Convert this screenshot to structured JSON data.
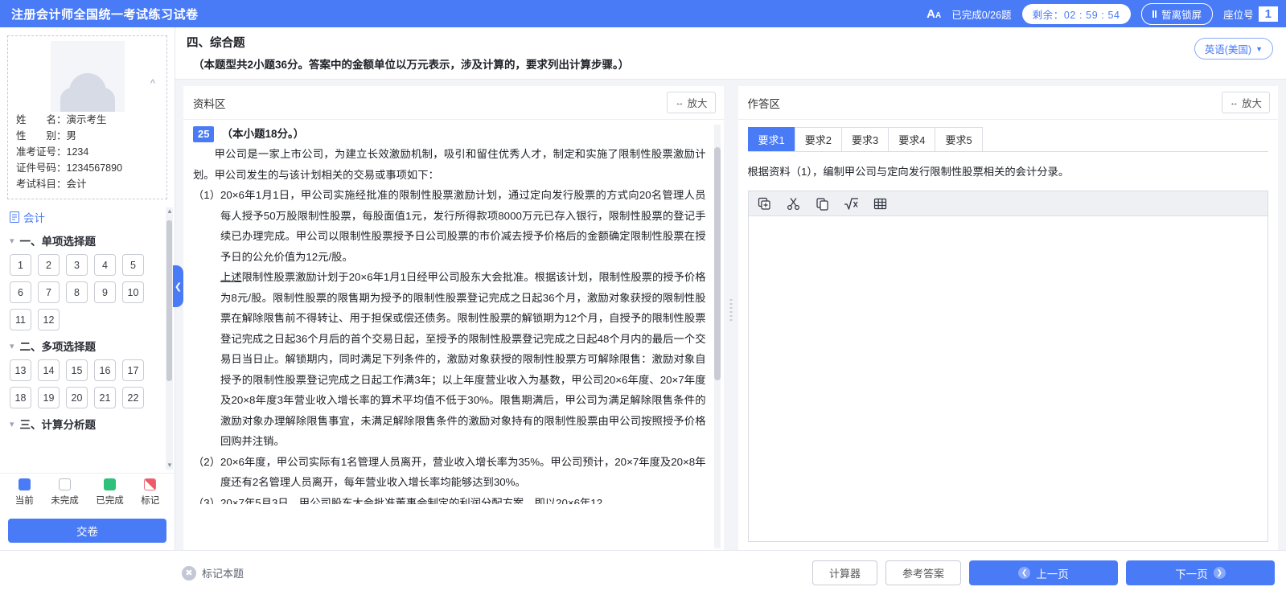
{
  "header": {
    "title": "注册会计师全国统一考试练习试卷",
    "font_size_icon": "font-size-icon",
    "done_count": "已完成0/26题",
    "timer": "剩余：02 : 59 : 54",
    "lock_label": "暂离锁屏",
    "seat_label": "座位号",
    "seat_number": "1",
    "accent_color": "#4a7bf7"
  },
  "sidebar": {
    "candidate": {
      "rows": [
        {
          "label": "姓　　名：",
          "value": "演示考生"
        },
        {
          "label": "性　　别：",
          "value": "男"
        },
        {
          "label": "准考证号：",
          "value": "1234"
        },
        {
          "label": "证件号码：",
          "value": "1234567890"
        },
        {
          "label": "考试科目：",
          "value": "会计"
        }
      ]
    },
    "subject": "会计",
    "sections": [
      {
        "title": "一、单项选择题",
        "questions": [
          "1",
          "2",
          "3",
          "4",
          "5",
          "6",
          "7",
          "8",
          "9",
          "10",
          "11",
          "12"
        ]
      },
      {
        "title": "二、多项选择题",
        "questions": [
          "13",
          "14",
          "15",
          "16",
          "17",
          "18",
          "19",
          "20",
          "21",
          "22"
        ]
      },
      {
        "title": "三、计算分析题",
        "questions": []
      }
    ],
    "legend": [
      {
        "label": "当前",
        "color": "#4a7bf7"
      },
      {
        "label": "未完成",
        "color": "#ffffff"
      },
      {
        "label": "已完成",
        "color": "#2fc07a"
      },
      {
        "label": "标记",
        "color": "#ec5b67"
      }
    ],
    "submit_label": "交卷"
  },
  "main": {
    "question_type_title": "四、综合题",
    "question_type_sub": "（本题型共2小题36分。答案中的金额单位以万元表示，涉及计算的，要求列出计算步骤。）",
    "language": "英语(美国)",
    "material": {
      "pane_title": "资料区",
      "zoom_label": "放大",
      "question_number": "25",
      "score_note": "（本小题18分。）",
      "intro": "甲公司是一家上市公司，为建立长效激励机制，吸引和留住优秀人才，制定和实施了限制性股票激励计划。甲公司发生的与该计划相关的交易或事项如下：",
      "items": [
        {
          "mark": "（1）",
          "text": "20×6年1月1日，甲公司实施经批准的限制性股票激励计划，通过定向发行股票的方式向20名管理人员每人授予50万股限制性股票，每股面值1元，发行所得款项8000万元已存入银行，限制性股票的登记手续已办理完成。甲公司以限制性股票授予日公司股票的市价减去授予价格后的金额确定限制性股票在授予日的公允价值为12元/股。",
          "sub_underline": "上述",
          "sub_text": "限制性股票激励计划于20×6年1月1日经甲公司股东大会批准。根据该计划，限制性股票的授予价格为8元/股。限制性股票的限售期为授予的限制性股票登记完成之日起36个月，激励对象获授的限制性股票在解除限售前不得转让、用于担保或偿还债务。限制性股票的解锁期为12个月，自授予的限制性股票登记完成之日起36个月后的首个交易日起，至授予的限制性股票登记完成之日起48个月内的最后一个交易日当日止。解锁期内，同时满足下列条件的，激励对象获授的限制性股票方可解除限售：激励对象自授予的限制性股票登记完成之日起工作满3年；以上年度营业收入为基数，甲公司20×6年度、20×7年度及20×8年度3年营业收入增长率的算术平均值不低于30%。限售期满后，甲公司为满足解除限售条件的激励对象办理解除限售事宜，未满足解除限售条件的激励对象持有的限制性股票由甲公司按照授予价格回购并注销。"
        },
        {
          "mark": "（2）",
          "text": "20×6年度，甲公司实际有1名管理人员离开，营业收入增长率为35%。甲公司预计，20×7年度及20×8年度还有2名管理人员离开，每年营业收入增长率均能够达到30%。"
        },
        {
          "mark": "（3）",
          "text": "20×7年5月3日，甲公司股东大会批准董事会制定的利润分配方案，即以20×6年12"
        }
      ]
    },
    "answer": {
      "pane_title": "作答区",
      "zoom_label": "放大",
      "tabs": [
        "要求1",
        "要求2",
        "要求3",
        "要求4",
        "要求5"
      ],
      "active_tab": "要求1",
      "requirement_text": "根据资料（1），编制甲公司与定向发行限制性股票相关的会计分录。",
      "toolbar_icons": [
        "paste-icon",
        "cut-icon",
        "copy-icon",
        "formula-icon",
        "table-icon"
      ],
      "editor_value": ""
    }
  },
  "bottom": {
    "flag_label": "标记本题",
    "calculator_label": "计算器",
    "answer_key_label": "参考答案",
    "prev_label": "上一页",
    "next_label": "下一页"
  }
}
